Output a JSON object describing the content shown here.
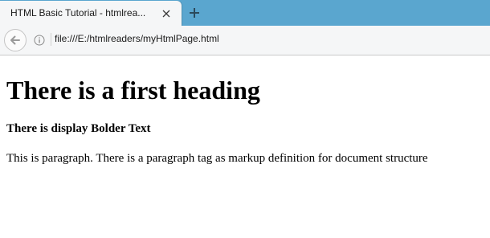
{
  "browser": {
    "tab": {
      "title": "HTML Basic Tutorial - htmlrea..."
    },
    "address_bar": {
      "url": "file:///E:/htmlreaders/myHtmlPage.html"
    },
    "icons": {
      "close": "close-icon",
      "new_tab": "plus-icon",
      "back": "arrow-left-icon",
      "info": "info-icon"
    },
    "colors": {
      "tabstrip": "#5aa6cf",
      "toolbar": "#f5f6f7"
    }
  },
  "page": {
    "heading": "There is a first heading",
    "bold_text": "There is display Bolder Text",
    "paragraph": "This is paragraph. There is a paragraph tag as markup definition for document structure"
  }
}
